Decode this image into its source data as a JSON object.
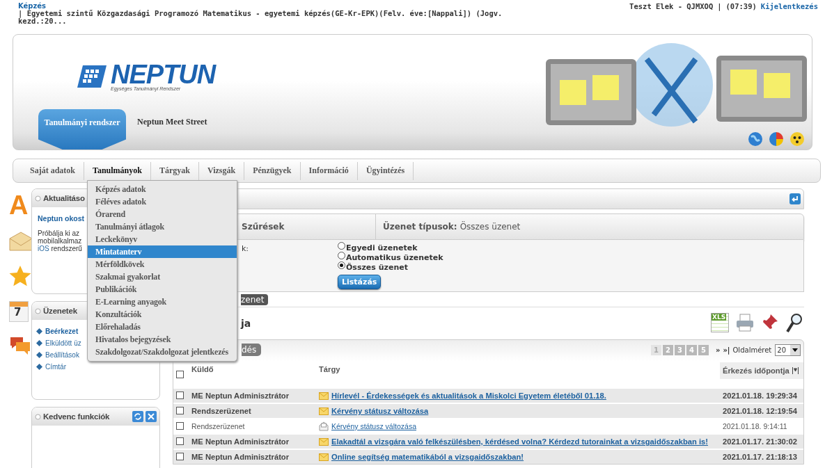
{
  "top_bar": {
    "training_link": "Képzés",
    "training_detail": "| Egyetemi szintű Közgazdasági Programozó Matematikus - egyetemi képzés(GE-Kr-EPK)(Felv. éve:[Nappali]) (Jogv. kezd.:20...",
    "user": "Teszt Elek - QJMXOQ",
    "separator": "|",
    "session_time": "(07:39)",
    "logout": "Kijelentkezés"
  },
  "header": {
    "logo_text": "NEPTUN",
    "logo_subtitle": "Egységes Tanulmányi Rendszer",
    "tabs": [
      {
        "label": "Tanulmányi rendszer",
        "selected": true
      },
      {
        "label": "Neptun Meet Street",
        "selected": false
      }
    ]
  },
  "menu": {
    "items": [
      {
        "label": "Saját adatok",
        "selected": false
      },
      {
        "label": "Tanulmányok",
        "selected": true
      },
      {
        "label": "Tárgyak",
        "selected": false
      },
      {
        "label": "Vizsgák",
        "selected": false
      },
      {
        "label": "Pénzügyek",
        "selected": false
      },
      {
        "label": "Információ",
        "selected": false
      },
      {
        "label": "Ügyintézés",
        "selected": false
      }
    ],
    "dropdown": [
      {
        "label": "Képzés adatok",
        "selected": false
      },
      {
        "label": "Féléves adatok",
        "selected": false
      },
      {
        "label": "Órarend",
        "selected": false
      },
      {
        "label": "Tanulmányi átlagok",
        "selected": false
      },
      {
        "label": "Leckekönyv",
        "selected": false
      },
      {
        "label": "Mintatanterv",
        "selected": true
      },
      {
        "label": "Mérföldkövek",
        "selected": false
      },
      {
        "label": "Szakmai gyakorlat",
        "selected": false
      },
      {
        "label": "Publikációk",
        "selected": false
      },
      {
        "label": "E-Learning anyagok",
        "selected": false
      },
      {
        "label": "Konzultációk",
        "selected": false
      },
      {
        "label": "Előrehaladás",
        "selected": false
      },
      {
        "label": "Hivatalos bejegyzések",
        "selected": false
      },
      {
        "label": "Szakdolgozat/Szakdolgozat jelentkezés",
        "selected": false
      }
    ]
  },
  "side_icons": {
    "letter": "A",
    "calendar_day": "7"
  },
  "sidebar": {
    "news": {
      "title": "Aktualitáso",
      "headline": "Neptun okost",
      "lines": [
        "Próbálja ki az",
        "mobilalkalmaz"
      ],
      "link": "iOS",
      "line_rest": "rendszerű"
    },
    "messages": {
      "title": "Üzenetek",
      "items": [
        {
          "label": "Beérkezet",
          "selected": true
        },
        {
          "label": "Elküldött üz",
          "selected": false
        },
        {
          "label": "Beállítások",
          "selected": false
        },
        {
          "label": "Címtár",
          "selected": false
        }
      ]
    },
    "favorites": {
      "title": "Kedvenc funkciók"
    }
  },
  "main": {
    "filter": {
      "tab": "Szűrések",
      "types_label": "Üzenet típusok:",
      "types_value": "Összes üzenet",
      "field_label": "k:",
      "options": [
        {
          "label": "Egyedi üzenetek",
          "selected": false
        },
        {
          "label": "Automatikus üzenetek",
          "selected": false
        },
        {
          "label": "Összes üzenet",
          "selected": true
        }
      ],
      "button": "Listázás"
    },
    "list_tab": "zenet",
    "title": "ja",
    "export_label": "XLS",
    "table": {
      "tab": "dés",
      "pages": [
        {
          "label": "1",
          "selected": true
        },
        {
          "label": "2",
          "selected": false
        },
        {
          "label": "3",
          "selected": false
        },
        {
          "label": "4",
          "selected": false
        },
        {
          "label": "5",
          "selected": false
        }
      ],
      "next": "»",
      "last": "»|",
      "page_size_label": "Oldalméret",
      "page_size": "20",
      "header_checked": false,
      "columns": [
        "Küldő",
        "Tárgy",
        "Érkezés időpontja"
      ],
      "rows": [
        {
          "checked": false,
          "unread": true,
          "sender": "ME Neptun Adminisztrátor",
          "subject": "Hírlevél - Érdekességek és aktualitások a Miskolci Egyetem életéből 01.18.",
          "received": "2021.01.18. 19:29:34"
        },
        {
          "checked": false,
          "unread": true,
          "sender": "Rendszerüzenet",
          "subject": "Kérvény státusz változása",
          "received": "2021.01.18. 12:19:54"
        },
        {
          "checked": false,
          "unread": false,
          "sender": "Rendszerüzenet",
          "subject": "Kérvény státusz változása",
          "received": "2021.01.18. 9:14:11"
        },
        {
          "checked": false,
          "unread": true,
          "sender": "ME Neptun Adminisztrátor",
          "subject": "Elakadtál a vizsgára való felkészülésben, kérdésed volna? Kérdezd tutorainkat a vizsgaidőszakban is!",
          "received": "2021.01.17. 21:30:02"
        },
        {
          "checked": false,
          "unread": true,
          "sender": "ME Neptun Adminisztrátor",
          "subject": "Online segítség matematikából a vizsgaidőszakban!",
          "received": "2021.01.17. 21:18:13"
        }
      ]
    }
  }
}
